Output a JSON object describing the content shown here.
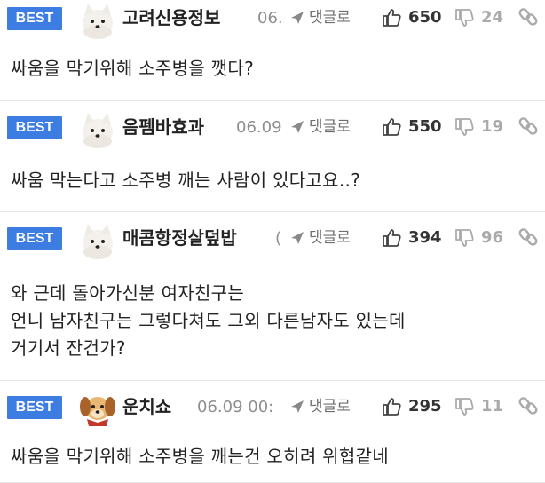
{
  "comments": [
    {
      "badge": "BEST",
      "nickname": "고려신용정보",
      "date": "06.",
      "reply_label": "댓글로",
      "likes": "650",
      "dislikes": "24",
      "avatar": "white-puppy",
      "lines": [
        "싸움을 막기위해 소주병을 깻다?"
      ]
    },
    {
      "badge": "BEST",
      "nickname": "음펨바효과",
      "date": "06.09",
      "reply_label": "댓글로",
      "likes": "550",
      "dislikes": "19",
      "avatar": "white-puppy",
      "lines": [
        "싸움 막는다고 소주병 깨는 사람이 있다고요..?"
      ]
    },
    {
      "badge": "BEST",
      "nickname": "매콤항정살덮밥",
      "date": "(",
      "reply_label": "댓글로",
      "likes": "394",
      "dislikes": "96",
      "avatar": "white-puppy",
      "lines": [
        "와 근데 돌아가신분 여자친구는",
        "언니 남자친구는 그렇다쳐도 그외 다른남자도 있는데",
        "거기서 잔건가?"
      ]
    },
    {
      "badge": "BEST",
      "nickname": "운치쇼",
      "date": "06.09 00:",
      "reply_label": "댓글로",
      "likes": "295",
      "dislikes": "11",
      "avatar": "brown-puppy",
      "lines": [
        "싸움을 막기위해 소주병을 깨는건 오히려 위협같네"
      ]
    }
  ],
  "colors": {
    "badge_bg": "#3d7ce0",
    "text": "#222222",
    "muted": "#8e8e8e",
    "divider": "#e6e6e6"
  },
  "icons": [
    "reply-arrow-icon",
    "thumbs-up-icon",
    "thumbs-down-icon",
    "link-icon"
  ]
}
